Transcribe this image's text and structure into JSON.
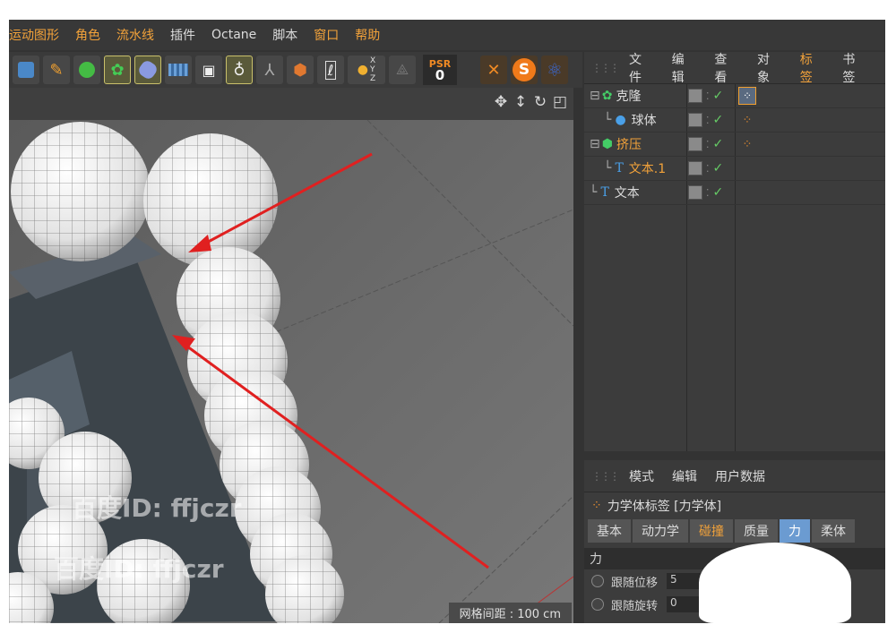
{
  "menu": {
    "items": [
      {
        "label": "运动图形",
        "color": "orange"
      },
      {
        "label": "角色",
        "color": "orange"
      },
      {
        "label": "流水线",
        "color": "orange"
      },
      {
        "label": "插件",
        "color": "white"
      },
      {
        "label": "Octane",
        "color": "white"
      },
      {
        "label": "脚本",
        "color": "white"
      },
      {
        "label": "窗口",
        "color": "orange"
      },
      {
        "label": "帮助",
        "color": "orange"
      }
    ]
  },
  "toolbar": {
    "psr_label": "PSR",
    "psr_value": "0",
    "s_label": "S",
    "xyz_labels": [
      "X",
      "Y",
      "Z"
    ],
    "icons": [
      "cube-icon",
      "pen-icon",
      "sphere-green-icon",
      "cloner-icon",
      "deformer-icon",
      "floor-icon",
      "camera-icon",
      "light-icon",
      "axis-icon",
      "extrude-icon",
      "render-icon",
      "coord-icon",
      "lock-xyz-icon"
    ]
  },
  "viewport": {
    "nav_icons": [
      "move-icon",
      "updown-icon",
      "rotate-icon",
      "maximize-icon"
    ],
    "grid_label": "网格间距 : 100 cm",
    "watermarks": [
      "百度ID: ffjczr",
      "百度ID: ffjczr"
    ]
  },
  "object_manager": {
    "menu": [
      {
        "label": "文件",
        "hl": false
      },
      {
        "label": "编辑",
        "hl": false
      },
      {
        "label": "查看",
        "hl": false
      },
      {
        "label": "对象",
        "hl": false
      },
      {
        "label": "标签",
        "hl": true
      },
      {
        "label": "书签",
        "hl": false
      }
    ],
    "objects": [
      {
        "tree": "⊟",
        "icon": "cloner-icon",
        "name": "克隆",
        "color": "#dcdcdc",
        "indent": 0
      },
      {
        "tree": "└",
        "icon": "sphere-icon",
        "name": "球体",
        "color": "#dcdcdc",
        "indent": 1
      },
      {
        "tree": "⊟",
        "icon": "extrude-icon",
        "name": "挤压",
        "color": "#f2a23a",
        "indent": 0
      },
      {
        "tree": "└",
        "icon": "text-icon",
        "name": "文本.1",
        "color": "#f2a23a",
        "indent": 1
      },
      {
        "tree": "└",
        "icon": "text-icon",
        "name": "文本",
        "color": "#dcdcdc",
        "indent": 0
      }
    ]
  },
  "attribute_manager": {
    "menu": [
      "模式",
      "编辑",
      "用户数据"
    ],
    "title": "力学体标签 [力学体]",
    "tabs": [
      {
        "label": "基本",
        "state": ""
      },
      {
        "label": "动力学",
        "state": ""
      },
      {
        "label": "碰撞",
        "state": "sel2"
      },
      {
        "label": "质量",
        "state": ""
      },
      {
        "label": "力",
        "state": "active"
      },
      {
        "label": "柔体",
        "state": ""
      }
    ],
    "section": "力",
    "rows": [
      {
        "label": "跟随位移",
        "value": "5"
      },
      {
        "label": "跟随旋转",
        "value": "0"
      }
    ]
  }
}
